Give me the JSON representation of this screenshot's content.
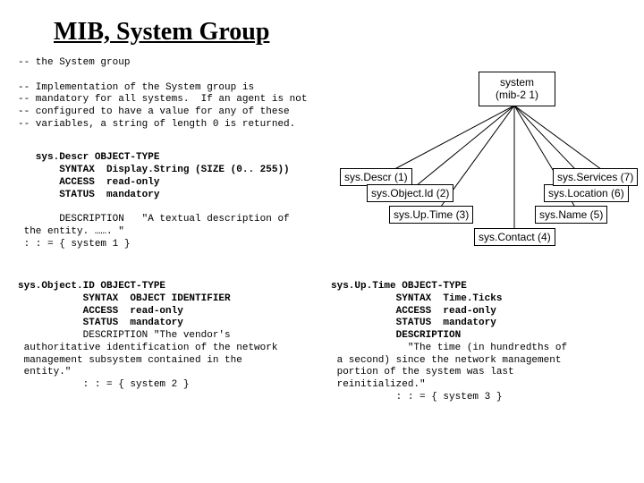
{
  "title": "MIB, System Group",
  "intro": "-- the System group\n\n-- Implementation of the System group is\n-- mandatory for all systems.  If an agent is not\n-- configured to have a value for any of these\n-- variables, a string of length 0 is returned.",
  "sysDescr": {
    "header": "   sys.Descr OBJECT-TYPE",
    "syntax": "       SYNTAX  Display.String (SIZE (0.. 255))",
    "access": "       ACCESS  read-only",
    "status": "       STATUS  mandatory",
    "desc1": "       DESCRIPTION   \"A textual description of",
    "desc2": " the entity. ……. \"",
    "assign": " : : = { system 1 }"
  },
  "sysObjectID": {
    "header": "sys.Object.ID OBJECT-TYPE",
    "syntax": "           SYNTAX  OBJECT IDENTIFIER",
    "access": "           ACCESS  read-only",
    "status": "           STATUS  mandatory",
    "desc1": "           DESCRIPTION \"The vendor's",
    "desc2": " authoritative identification of the network",
    "desc3": " management subsystem contained in the",
    "desc4": " entity.\"",
    "assign": "           : : = { system 2 }"
  },
  "sysUpTime": {
    "header": "sys.Up.Time OBJECT-TYPE",
    "syntax": "           SYNTAX  Time.Ticks",
    "access": "           ACCESS  read-only",
    "status": "           STATUS  mandatory",
    "desc0": "           DESCRIPTION",
    "desc1": "             \"The time (in hundredths of",
    "desc2": " a second) since the network management",
    "desc3": " portion of the system was last",
    "desc4": " reinitialized.\"",
    "assign": "           : : = { system 3 }"
  },
  "tree": {
    "root1": "system",
    "root2": "(mib-2 1)",
    "n1": "sys.Descr (1)",
    "n2": "sys.Object.Id (2)",
    "n3": "sys.Up.Time (3)",
    "n4": "sys.Contact (4)",
    "n5": "sys.Name (5)",
    "n6": "sys.Location (6)",
    "n7": "sys.Services (7)"
  }
}
